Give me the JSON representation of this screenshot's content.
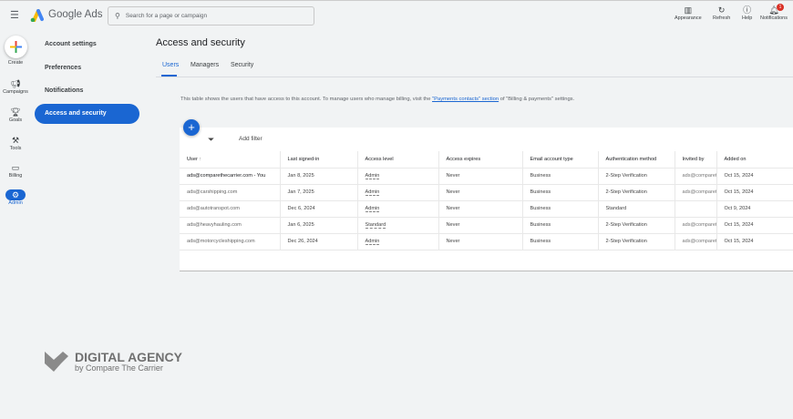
{
  "header": {
    "app_name": "Google Ads",
    "search_placeholder": "Search for a page or campaign",
    "actions": [
      {
        "label": "Appearance",
        "icon": "appearance-icon"
      },
      {
        "label": "Refresh",
        "icon": "refresh-icon"
      },
      {
        "label": "Help",
        "icon": "help-icon"
      },
      {
        "label": "Notifications",
        "icon": "bell-icon",
        "badge": "1"
      }
    ]
  },
  "rail": {
    "create": "Create",
    "items": [
      {
        "label": "Campaigns",
        "icon": "megaphone-icon"
      },
      {
        "label": "Goals",
        "icon": "trophy-icon"
      },
      {
        "label": "Tools",
        "icon": "tools-icon"
      },
      {
        "label": "Billing",
        "icon": "card-icon"
      },
      {
        "label": "Admin",
        "icon": "gear-icon",
        "active": true
      }
    ]
  },
  "nav": {
    "items": [
      "Account settings",
      "Preferences",
      "Notifications",
      "Access and security"
    ],
    "active": "Access and security"
  },
  "page": {
    "title": "Access and security",
    "tabs": [
      "Users",
      "Managers",
      "Security"
    ],
    "active_tab": "Users",
    "info_pre": "This table shows the users that have access to this account. To manage users who manage billing, visit the ",
    "info_link": "\"Payments contacts\" section",
    "info_post": " of \"Billing & payments\" settings.",
    "add_filter": "Add filter"
  },
  "table": {
    "columns": [
      "User",
      "Last signed-in",
      "Access level",
      "Access expires",
      "Email account type",
      "Authentication method",
      "Invited by",
      "Added on"
    ],
    "rows": [
      [
        "ads@comparethecarrier.com - You",
        "Jan 8, 2025",
        "Admin",
        "Never",
        "Business",
        "2-Step Verification",
        "ads@comparethe",
        "Oct 15, 2024"
      ],
      [
        "ads@carshipping.com",
        "Jan 7, 2025",
        "Admin",
        "Never",
        "Business",
        "2-Step Verification",
        "ads@comparethe",
        "Oct 15, 2024"
      ],
      [
        "ads@autotranspot.com",
        "Dec 6, 2024",
        "Admin",
        "Never",
        "Business",
        "Standard",
        "",
        "Oct 9, 2024"
      ],
      [
        "ads@heavyhauling.com",
        "Jan 6, 2025",
        "Standard",
        "Never",
        "Business",
        "2-Step Verification",
        "ads@comparethe",
        "Oct 15, 2024"
      ],
      [
        "ads@motorcycleshipping.com",
        "Dec 26, 2024",
        "Admin",
        "Never",
        "Business",
        "2-Step Verification",
        "ads@comparethe",
        "Oct 15, 2024"
      ]
    ]
  },
  "watermark": {
    "line1": "DIGITAL AGENCY",
    "line2": "by Compare The Carrier"
  },
  "colors": {
    "accent": "#1a66d2",
    "badge": "#d93025"
  }
}
